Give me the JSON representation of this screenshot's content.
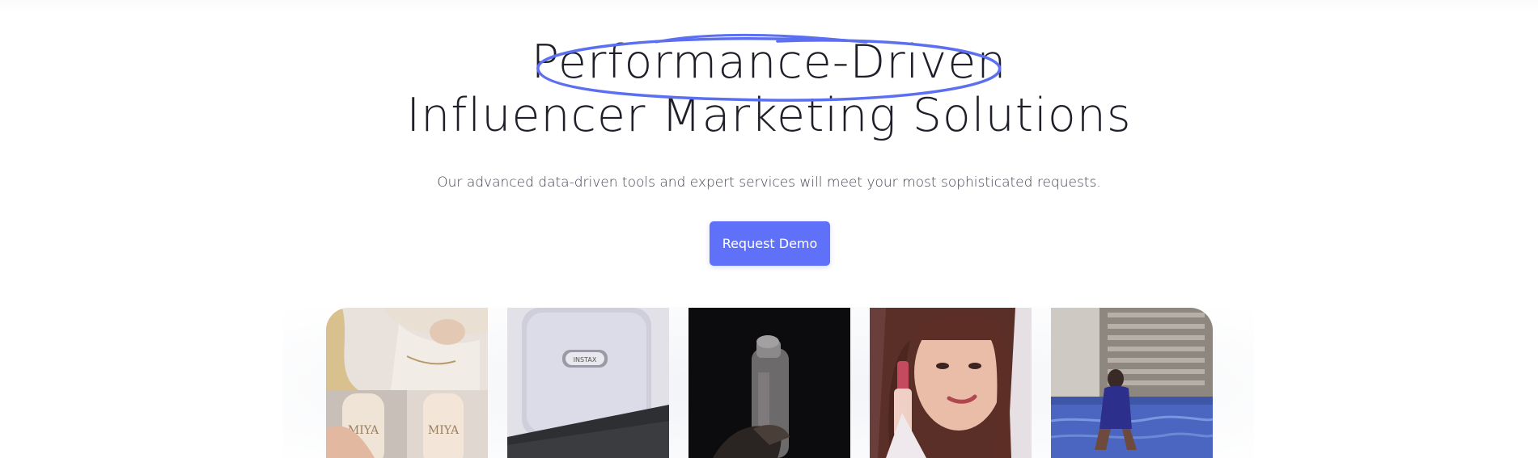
{
  "hero": {
    "title_line1": "Performance-Driven",
    "title_line2": "Influencer Marketing Solutions",
    "subtitle": "Our advanced data-driven tools and expert services will meet your most sophisticated requests.",
    "cta_label": "Request Demo"
  },
  "colors": {
    "accent": "#5f71f8",
    "scribble": "#5b6ff0",
    "title": "#1f1f2a",
    "subtitle": "#444454"
  },
  "icons": {
    "scribble": "hand-drawn-circle-highlight"
  },
  "gallery": {
    "images": [
      {
        "name": "blonde-woman-with-cosmetic-bottles"
      },
      {
        "name": "instant-photo-printer"
      },
      {
        "name": "hand-holding-bottle-in-dark"
      },
      {
        "name": "woman-holding-lipstick"
      },
      {
        "name": "woman-in-pool-by-building"
      }
    ],
    "printer_label": "INSTAX",
    "bottle_label": "MIYA"
  }
}
